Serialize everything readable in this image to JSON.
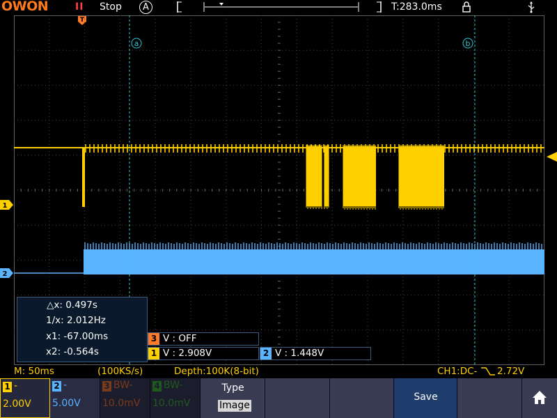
{
  "brand": {
    "logo": "OWON"
  },
  "top": {
    "run_state": "Stop",
    "trigger_mode": "A",
    "trigger_time": "T:283.0ms"
  },
  "cursors": {
    "a_label": "a",
    "b_label": "b",
    "delta_x": "△x: 0.497s",
    "inv_x": "1/x: 2.012Hz",
    "x1": "x1: -67.00ms",
    "x2": "x2: -0.564s"
  },
  "channel_readouts": {
    "ch3": {
      "num": "3",
      "text": "V : OFF"
    },
    "ch1": {
      "num": "1",
      "text": "V : 2.908V"
    },
    "ch2": {
      "num": "2",
      "text": "V : 1.448V"
    }
  },
  "markers": {
    "ch1": "1",
    "ch2": "2",
    "trigger": "T"
  },
  "bottom": {
    "timebase": "M: 50ms",
    "sample_rate": "(100KS/s)",
    "depth": "Depth:100K(8-bit)",
    "trigger_info_a": "CH1:DC-",
    "trigger_info_b": "2.72V"
  },
  "menu": {
    "ch1": {
      "num": "1",
      "top": "-",
      "scale": "2.00V"
    },
    "ch2": {
      "num": "2",
      "top": "-",
      "scale": "5.00V"
    },
    "ch3": {
      "num": "3",
      "top": "BW-",
      "scale": "10.0mV"
    },
    "ch4": {
      "num": "4",
      "top": "BW-",
      "scale": "10.0mV"
    },
    "type_label": "Type",
    "type_value": "Image",
    "save_label": "Save"
  },
  "colors": {
    "ch1": "#ffd000",
    "ch2": "#5ab4ff",
    "ch3": "#ff7b2a",
    "ch4": "#38c838",
    "cursor": "#30c8d8",
    "logo": "#ff7a1a"
  }
}
